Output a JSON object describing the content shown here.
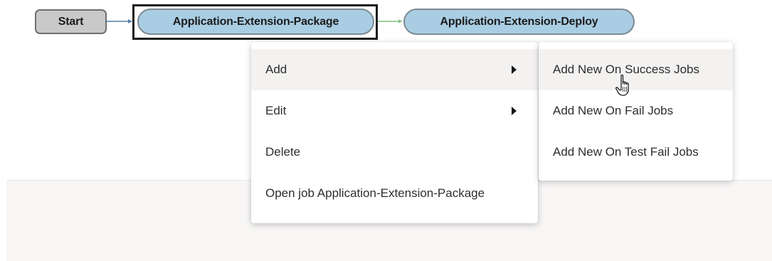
{
  "pipeline": {
    "nodes": {
      "start": "Start",
      "package": "Application-Extension-Package",
      "deploy": "Application-Extension-Deploy"
    },
    "selected_node": "Application-Extension-Package"
  },
  "context_menu": {
    "items": [
      {
        "label": "Add",
        "has_submenu": true
      },
      {
        "label": "Edit",
        "has_submenu": true
      },
      {
        "label": "Delete",
        "has_submenu": false
      },
      {
        "label": "Open job Application-Extension-Package",
        "has_submenu": false
      }
    ],
    "hovered": "Add"
  },
  "submenu": {
    "items": [
      {
        "label": "Add New On Success Jobs"
      },
      {
        "label": "Add New On Fail Jobs"
      },
      {
        "label": "Add New On Test Fail Jobs"
      }
    ],
    "hovered": "Add New On Success Jobs"
  },
  "colors": {
    "node_pill_fill": "#a9cde3",
    "node_start_fill": "#c9c9c9",
    "connector_blue": "#4d7fa8",
    "connector_green": "#7fbf7f",
    "menu_hover": "#f3f2f1",
    "lower_panel": "#f7f6f5"
  },
  "icons": {
    "submenu_arrow": "caret-right-icon",
    "pointer": "hand-pointer-cursor-icon"
  }
}
